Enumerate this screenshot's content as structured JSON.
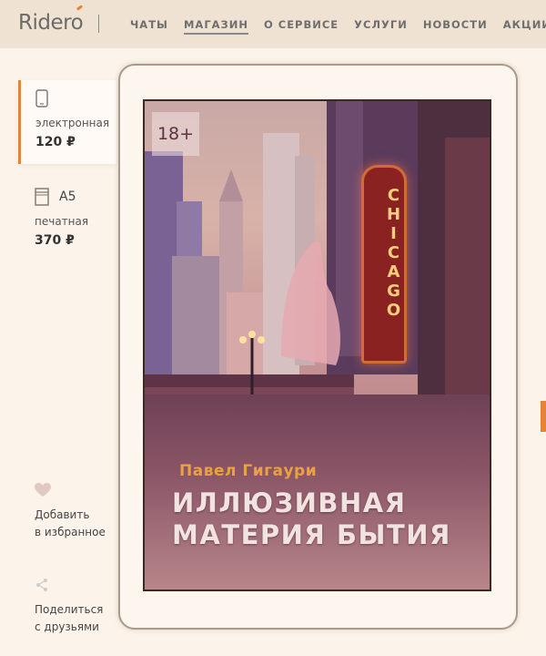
{
  "header": {
    "logo": "Ridero",
    "nav": [
      {
        "label": "ЧАТЫ",
        "active": false
      },
      {
        "label": "МАГАЗИН",
        "active": true
      },
      {
        "label": "О СЕРВИСЕ",
        "active": false
      },
      {
        "label": "УСЛУГИ",
        "active": false
      },
      {
        "label": "НОВОСТИ",
        "active": false
      },
      {
        "label": "АКЦИИ",
        "active": false
      }
    ]
  },
  "formats": {
    "ebook": {
      "icon": "tablet-icon",
      "label": "электронная",
      "price": "120 ₽",
      "selected": true
    },
    "print": {
      "icon": "book-icon",
      "size": "A5",
      "label": "печатная",
      "price": "370 ₽",
      "selected": false
    }
  },
  "actions": {
    "favorite": {
      "icon": "heart-icon",
      "line1": "Добавить",
      "line2": "в избранное"
    },
    "share": {
      "icon": "share-icon",
      "line1": "Поделиться",
      "line2": "с друзьями"
    }
  },
  "cover": {
    "age_rating": "18+",
    "author": "Павел Гигаури",
    "title_line1": "ИЛЛЮЗИВНАЯ",
    "title_line2": "МАТЕРИЯ БЫТИЯ",
    "sign_text": "CHICAGO"
  },
  "colors": {
    "accent": "#e2853c",
    "header_bg": "#f0e2d3",
    "page_bg": "#fcf4ea"
  }
}
